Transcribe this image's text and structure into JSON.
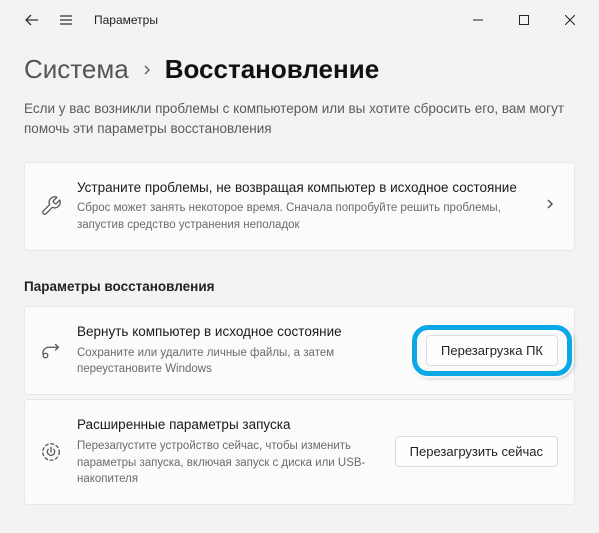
{
  "titlebar": {
    "title": "Параметры"
  },
  "breadcrumb": {
    "parent": "Система",
    "current": "Восстановление"
  },
  "intro": "Если у вас возникли проблемы с компьютером или вы хотите сбросить его, вам могут помочь эти параметры восстановления",
  "troubleshoot": {
    "title": "Устраните проблемы, не возвращая компьютер в исходное состояние",
    "desc": "Сброс может занять некоторое время. Сначала попробуйте решить проблемы, запустив средство устранения неполадок"
  },
  "section_title": "Параметры восстановления",
  "reset": {
    "title": "Вернуть компьютер в исходное состояние",
    "desc": "Сохраните или удалите личные файлы, а затем переустановите Windows",
    "button": "Перезагрузка ПК"
  },
  "advanced": {
    "title": "Расширенные параметры запуска",
    "desc": "Перезапустите устройство сейчас, чтобы изменить параметры запуска, включая запуск с диска или USB-накопителя",
    "button": "Перезагрузить сейчас"
  }
}
